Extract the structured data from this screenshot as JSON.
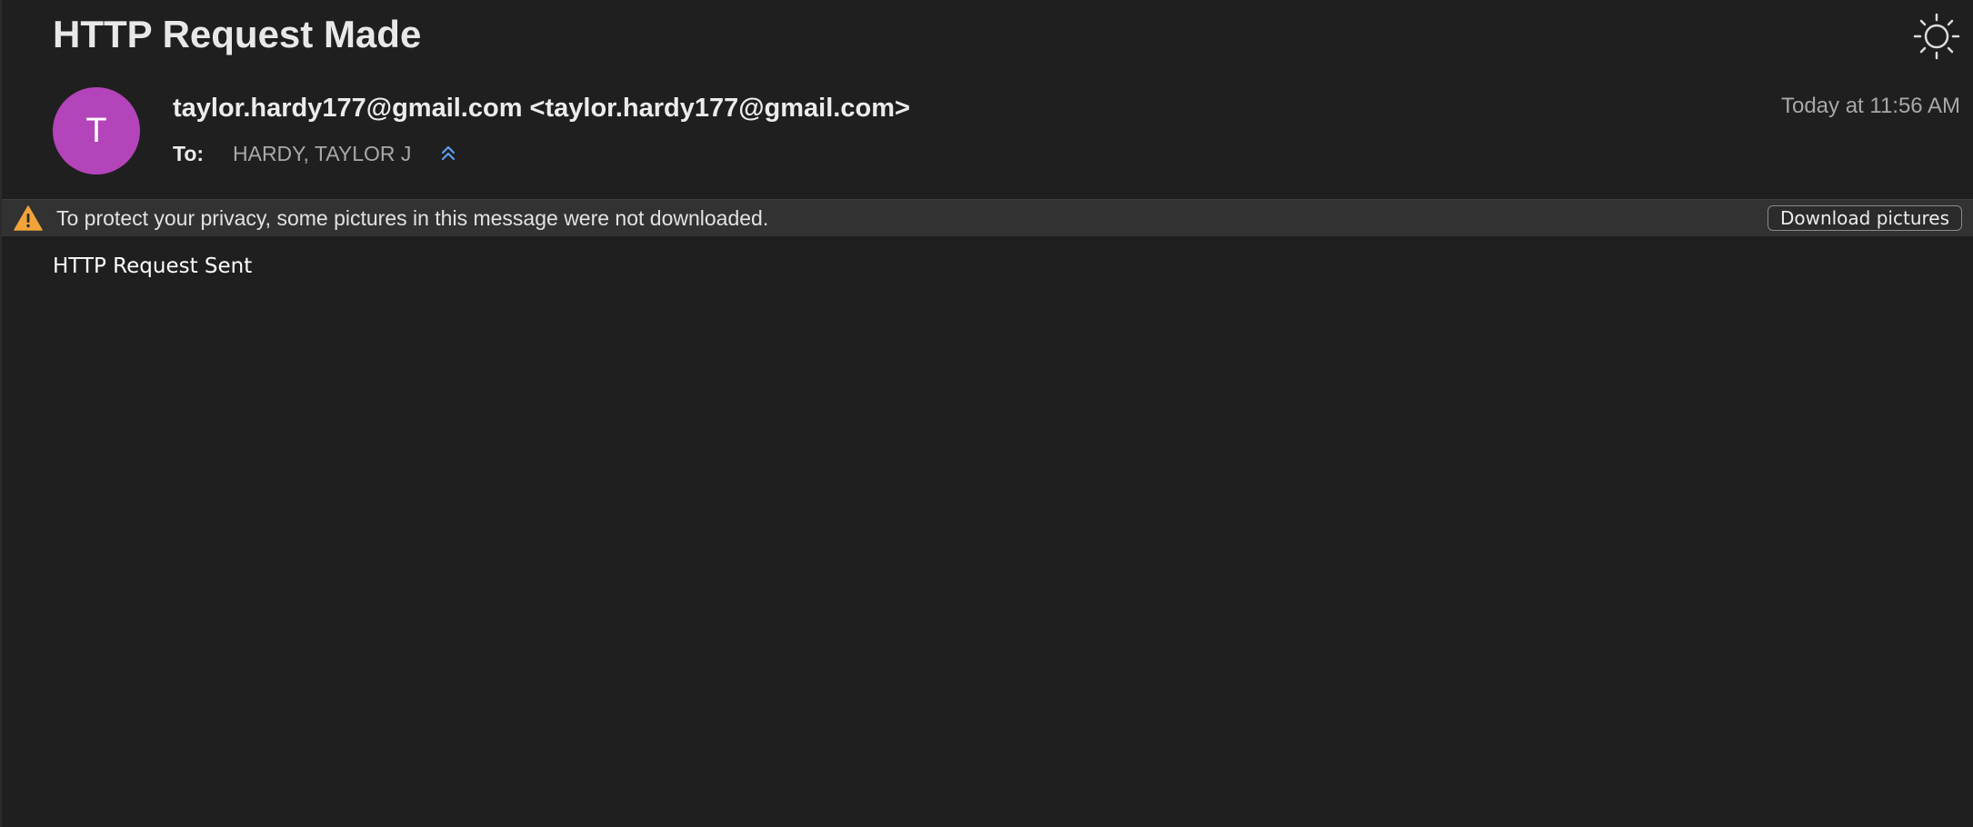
{
  "message": {
    "subject": "HTTP Request Made",
    "sender_initial": "T",
    "sender": "taylor.hardy177@gmail.com <taylor.hardy177@gmail.com>",
    "to_label": "To:",
    "to_value": "HARDY, TAYLOR J",
    "timestamp": "Today at 11:56 AM",
    "body": "HTTP Request Sent"
  },
  "privacy_banner": {
    "text": "To protect your privacy, some pictures in this message were not downloaded.",
    "button_label": "Download pictures",
    "icon": "warning-triangle-icon"
  },
  "toolbar": {
    "theme_icon": "sun-icon"
  },
  "colors": {
    "background": "#1f1f1f",
    "avatar": "#b444b9",
    "banner": "#323232",
    "warning": "#f2a33a",
    "collapse_accent": "#5e9cf2"
  }
}
